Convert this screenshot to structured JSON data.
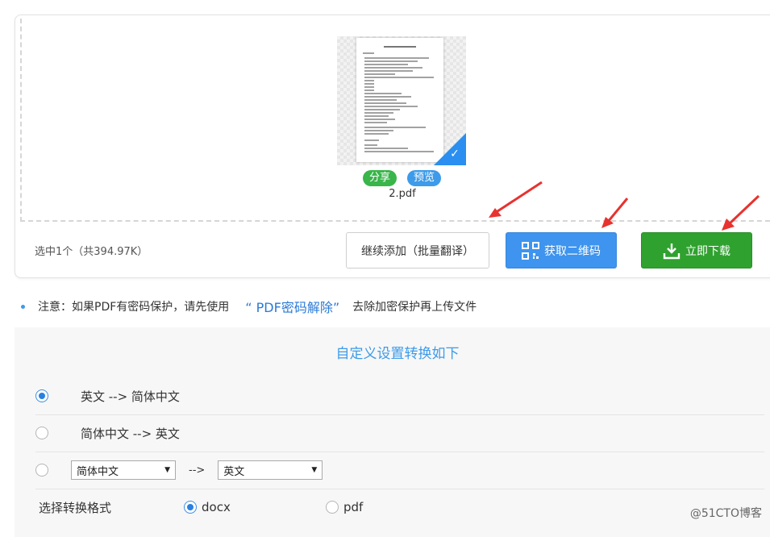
{
  "upload": {
    "share_label": "分享",
    "preview_label": "预览",
    "file_name": "2.pdf",
    "status": "选中1个（共394.97K）",
    "add_button": "继续添加（批量翻译）",
    "qr_button": "获取二维码",
    "download_button": "立即下载"
  },
  "notice": {
    "prefix": "注意：如果PDF有密码保护，请先使用",
    "link": "“ PDF密码解除”",
    "suffix": "去除加密保护再上传文件"
  },
  "settings": {
    "title": "自定义设置转换如下",
    "options": [
      {
        "label": "英文 --> 简体中文",
        "selected": true
      },
      {
        "label": "简体中文 --> 英文",
        "selected": false
      }
    ],
    "custom": {
      "from": "简体中文",
      "arrow": "-->",
      "to": "英文"
    },
    "format": {
      "label": "选择转换格式",
      "options": [
        {
          "label": "docx",
          "selected": true
        },
        {
          "label": "pdf",
          "selected": false
        }
      ]
    }
  },
  "watermark": "@51CTO博客",
  "colors": {
    "accent": "#3d9be9",
    "download": "#2fa12f",
    "qr": "#3e94ee",
    "annotation_arrow": "#e8322f"
  },
  "icons": {
    "file_selected": "check-icon",
    "qr": "qr-code-icon",
    "download": "download-icon"
  }
}
